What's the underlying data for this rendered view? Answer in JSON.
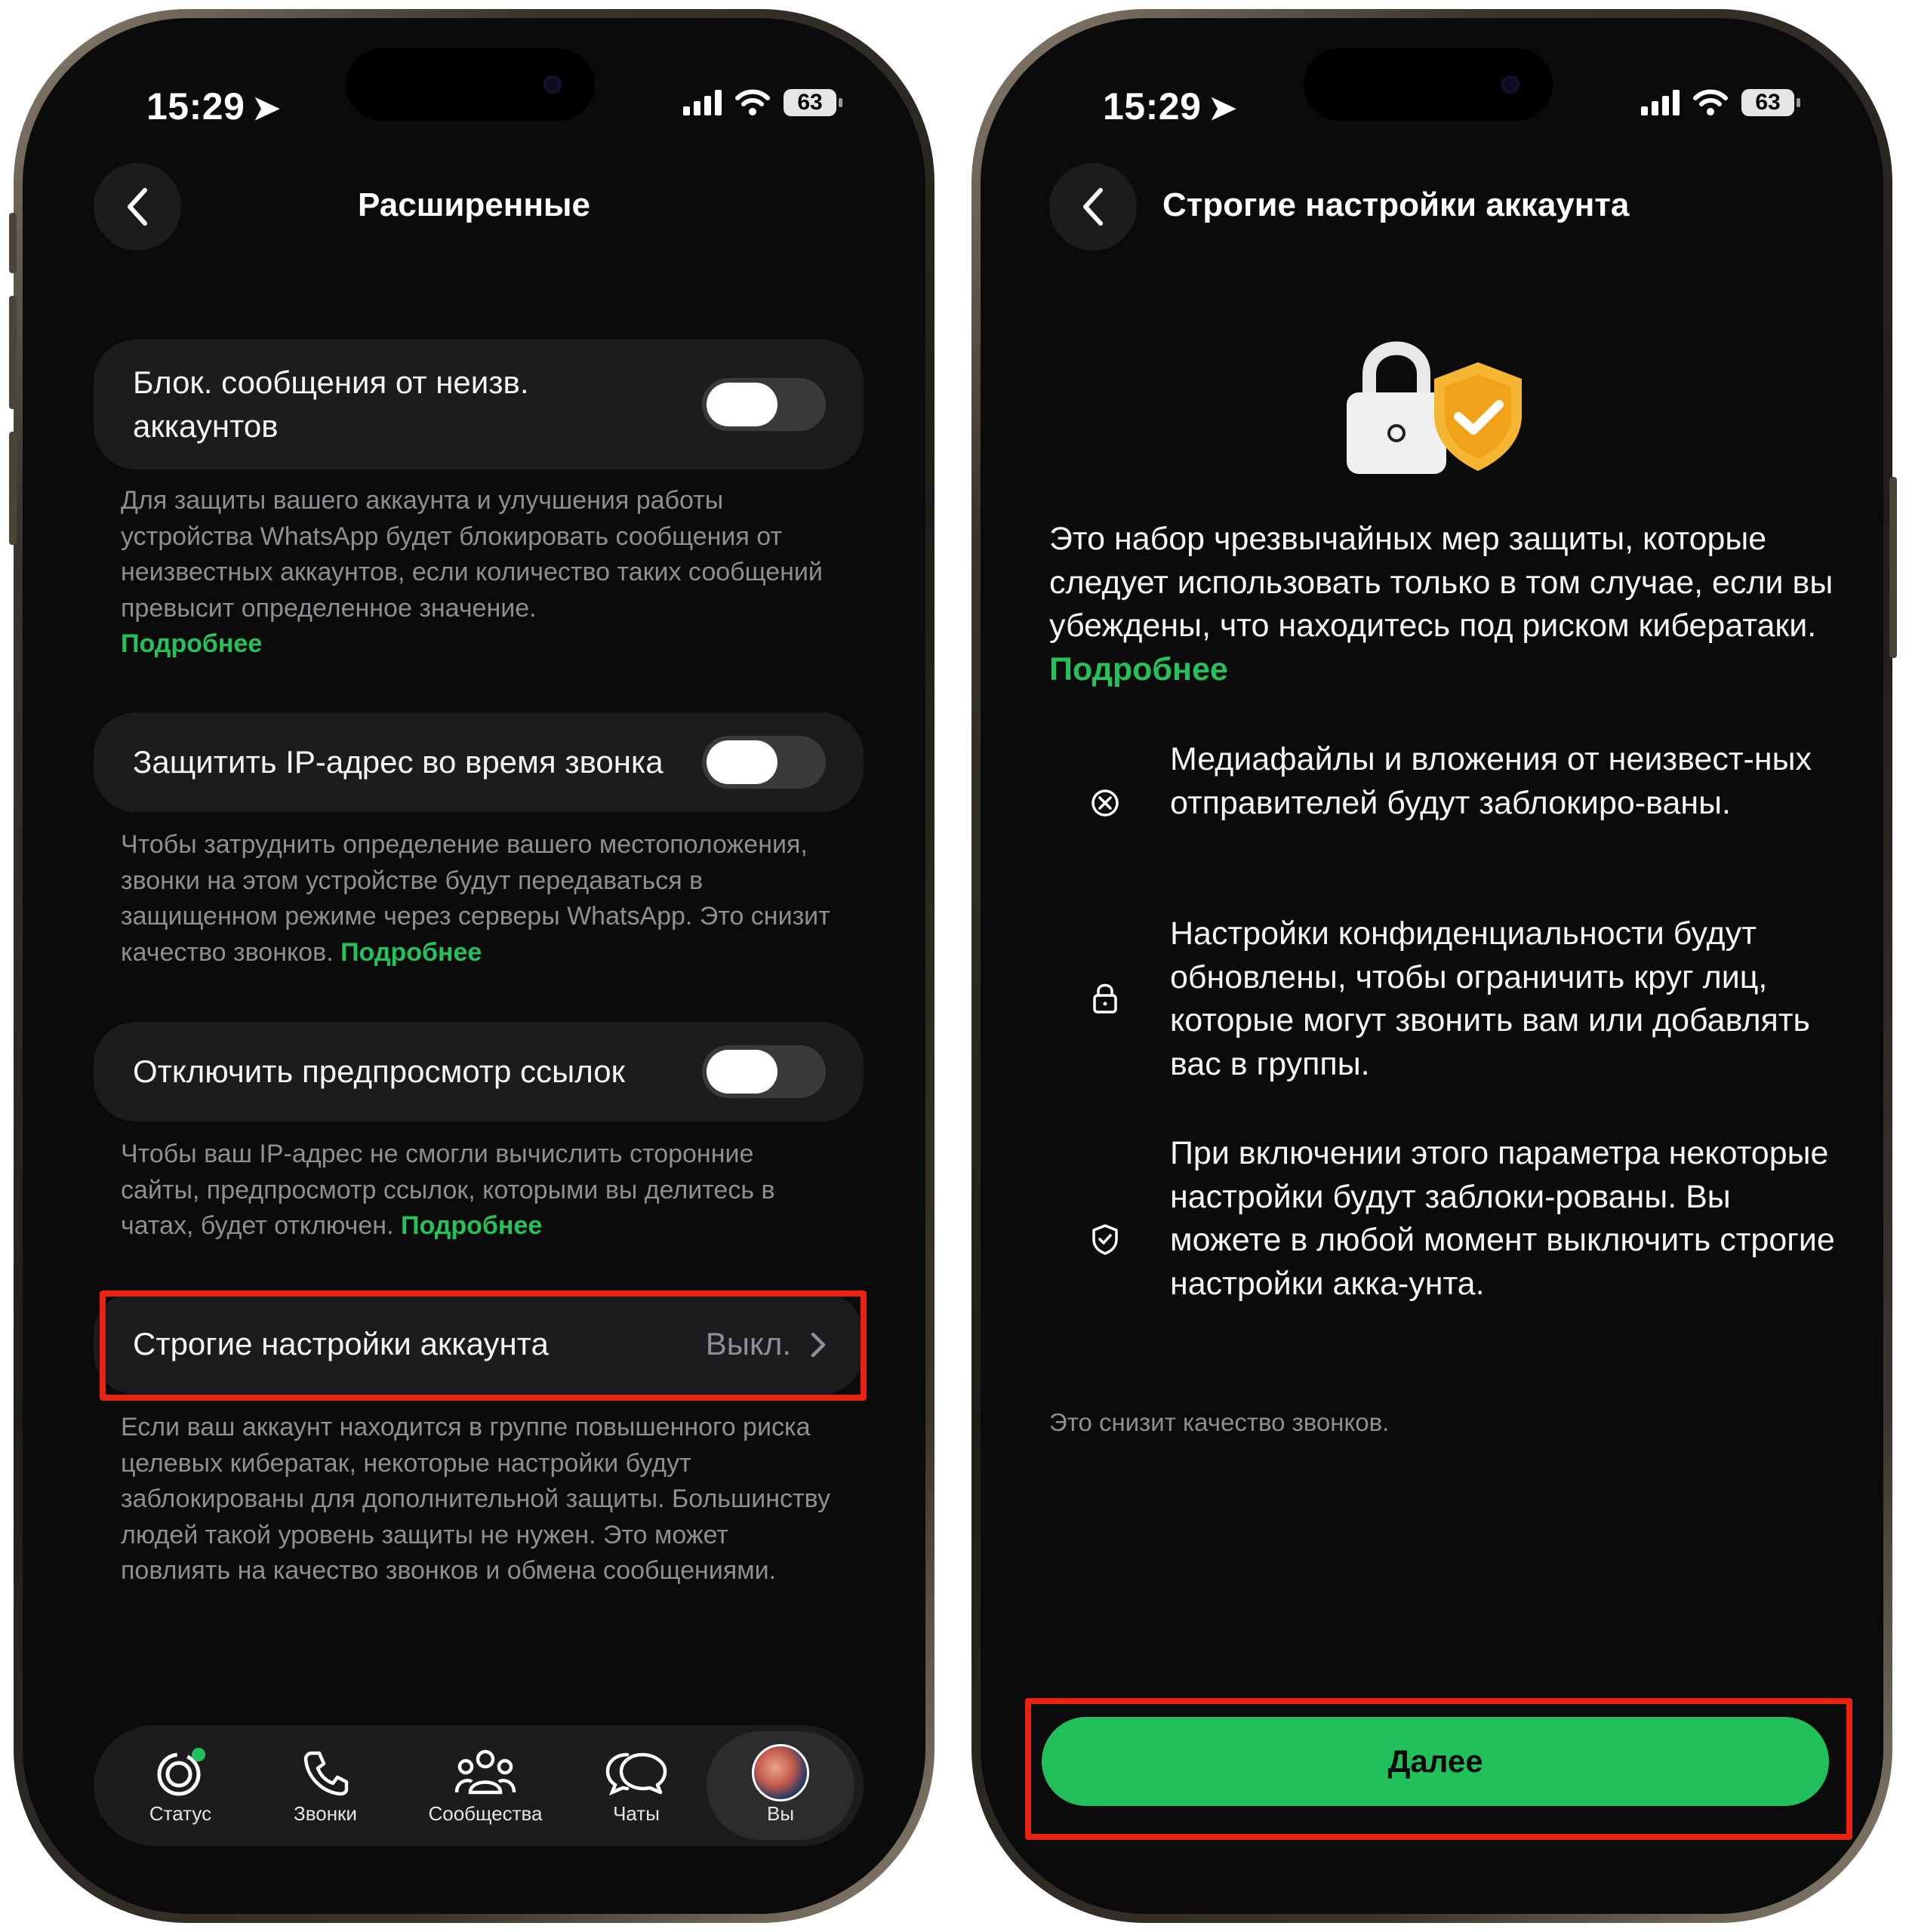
{
  "status_bar": {
    "time": "15:29",
    "battery": "63"
  },
  "left_screen": {
    "title": "Расширенные",
    "rows": [
      {
        "label": "Блок. сообщения от неизв. аккаунтов",
        "toggle": false,
        "description": "Для защиты вашего аккаунта и улучшения работы устройства WhatsApp будет блокировать сообщения от неизвестных аккаунтов, если количество таких сообщений превысит определенное значение.",
        "link": "Подробнее"
      },
      {
        "label": "Защитить IP-адрес во время звонка",
        "toggle": false,
        "description": "Чтобы затруднить определение вашего местоположения, звонки на этом устройстве будут передаваться в защищенном режиме через серверы WhatsApp. Это снизит качество звонков.",
        "link": "Подробнее"
      },
      {
        "label": "Отключить предпросмотр ссылок",
        "toggle": false,
        "description": "Чтобы ваш IP-адрес не смогли вычислить сторонние сайты, предпросмотр ссылок, которыми вы делитесь в чатах, будет отключен.",
        "link": "Подробнее"
      }
    ],
    "strict": {
      "label": "Строгие настройки аккаунта",
      "value": "Выкл.",
      "description": "Если ваш аккаунт находится в группе повышенного риска целевых кибератак, некоторые настройки будут заблокированы для дополнительной защиты. Большинству людей такой уровень защиты не нужен. Это может повлиять на качество звонков и обмена сообщениями."
    },
    "tabs": [
      {
        "label": "Статус",
        "icon": "status-icon"
      },
      {
        "label": "Звонки",
        "icon": "phone-icon"
      },
      {
        "label": "Сообщества",
        "icon": "communities-icon"
      },
      {
        "label": "Чаты",
        "icon": "chat-icon"
      },
      {
        "label": "Вы",
        "icon": "avatar"
      }
    ],
    "active_tab": "Вы"
  },
  "right_screen": {
    "title": "Строгие настройки аккаунта",
    "intro": "Это набор чрезвычайных мер защиты, которые следует использовать только в том случае, если вы убеждены, что находитесь под риском кибератаки.",
    "intro_link": "Подробнее",
    "features": [
      {
        "icon": "blocked-icon",
        "text": "Медиафайлы и вложения от неизвест-ных отправителей будут заблокиро-ваны."
      },
      {
        "icon": "lock-icon",
        "text": "Настройки конфиденциальности будут обновлены, чтобы ограничить круг лиц, которые могут звонить вам или добавлять вас в группы."
      },
      {
        "icon": "shield-check-icon",
        "text": "При включении этого параметра некоторые настройки будут заблоки-рованы. Вы можете в любой момент выключить строгие настройки акка-унта."
      }
    ],
    "note": "Это снизит качество звонков.",
    "button": "Далее"
  },
  "colors": {
    "accent": "#21c05a",
    "highlight": "#e8230f",
    "background": "#0b0b0b",
    "card": "#1c1c1e"
  }
}
